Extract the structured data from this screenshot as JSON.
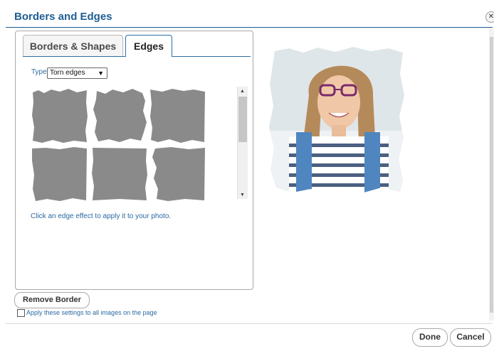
{
  "dialog": {
    "title": "Borders and Edges",
    "close_label": "✕"
  },
  "tabs": [
    {
      "label": "Borders & Shapes",
      "active": false
    },
    {
      "label": "Edges",
      "active": true
    }
  ],
  "type_select": {
    "label": "Type",
    "value": "Torn edges"
  },
  "edge_thumbnails": [
    "torn-edge-1",
    "torn-edge-2",
    "torn-edge-3",
    "torn-edge-4",
    "torn-edge-5",
    "torn-edge-6"
  ],
  "hint": "Click an edge effect to apply it to your photo.",
  "remove_border_label": "Remove Border",
  "apply_all_label": "Apply these settings to all images on the page",
  "apply_all_checked": false,
  "footer": {
    "done_label": "Done",
    "cancel_label": "Cancel"
  },
  "colors": {
    "title": "#1f5e93",
    "link_text": "#2a6aa2",
    "thumb_fill": "#8a8a8a"
  }
}
